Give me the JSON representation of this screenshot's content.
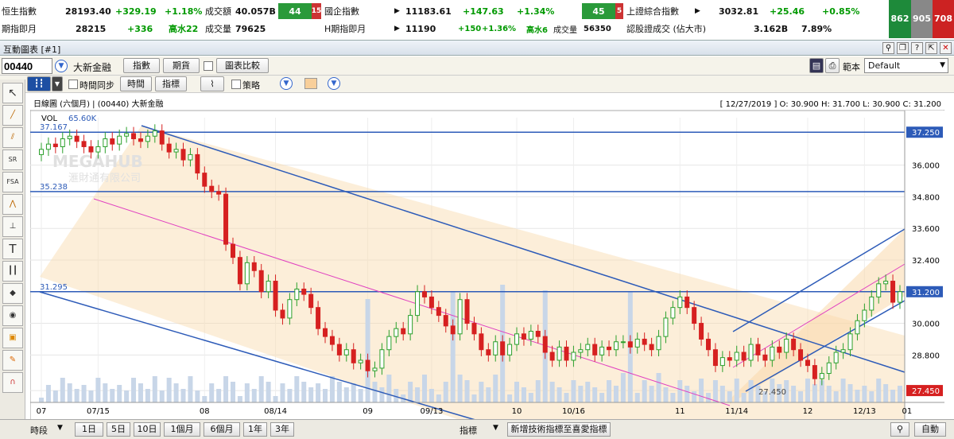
{
  "ticker": {
    "hsi_label": "恒生指數",
    "hsi_value": "28193.40",
    "hsi_change": "+329.19",
    "hsi_pct": "+1.18%",
    "hsi_turnover_label": "成交額",
    "hsi_turnover": "40.057B",
    "hsi_up_count": "44",
    "hsi_down_count": "15",
    "hsi_fut_label": "期指即月",
    "hsi_fut_value": "28215",
    "hsi_fut_change": "+336",
    "hsi_fut_premium": "高水22",
    "hsi_fut_vol_label": "成交量",
    "hsi_fut_vol": "79625",
    "hscei_label": "國企指數",
    "hscei_value": "11183.61",
    "hscei_change": "+147.63",
    "hscei_pct": "+1.34%",
    "hscei_up_count": "45",
    "hscei_down_count": "5",
    "hscei_fut_label": "H期指即月",
    "hscei_fut_value": "11190",
    "hscei_fut_change": "+150",
    "hscei_fut_pct": "+1.36%",
    "hscei_fut_premium": "高水6",
    "hscei_fut_vol_label": "成交量",
    "hscei_fut_vol": "56350",
    "sh_label": "上證綜合指數",
    "sh_value": "3032.81",
    "sh_change": "+25.46",
    "sh_pct": "+0.85%",
    "warrant_label": "認股證成交 (佔大市)",
    "warrant_value": "3.162B",
    "warrant_pct": "7.89%",
    "box1": "862",
    "box2": "905",
    "box3": "708"
  },
  "window": {
    "title": "互動圖表 [#1]"
  },
  "toolbar1": {
    "symbol": "00440",
    "name": "大新金融",
    "btn_index": "指數",
    "btn_futures": "期貨",
    "compare_label": "圖表比較",
    "template_label": "範本",
    "template_value": "Default"
  },
  "toolbar2": {
    "sync_label": "時間同步",
    "btn_time": "時間",
    "btn_indicator": "指標",
    "strategy_label": "策略"
  },
  "chart_header": {
    "left": "日線圖 (六個月) | (00440) 大新金融",
    "right": "[ 12/27/2019 ]  O: 30.900  H: 31.700  L: 30.900  C: 31.200",
    "vol_label": "VOL",
    "vol_value": "65.60K",
    "watermark": "MEGAHUB",
    "watermark_sub": "滙財通有限公司"
  },
  "left_tools": [
    "arrow",
    "trend",
    "channel",
    "SR",
    "FSA",
    "fibo",
    "level",
    "text",
    "multi",
    "eraser",
    "eye",
    "lock",
    "pencil",
    "magnet"
  ],
  "bottom": {
    "period_label": "時段",
    "periods": [
      "1日",
      "5日",
      "10日",
      "1個月",
      "6個月",
      "1年",
      "3年"
    ],
    "indicator_label": "指標",
    "add_indicator": "新增技術指標至喜愛指標",
    "btn_auto": "自動"
  },
  "chart_data": {
    "type": "candlestick",
    "yaxis_ticks": [
      37.25,
      36.0,
      34.8,
      33.6,
      32.4,
      31.2,
      30.0,
      28.8,
      27.45
    ],
    "ylim": [
      27.0,
      37.8
    ],
    "xaxis_labels": [
      "07",
      "07/15",
      "08",
      "08/14",
      "09",
      "09/13",
      "10",
      "10/16",
      "11",
      "11/14",
      "12",
      "12/13",
      "01"
    ],
    "hlines": [
      {
        "label": "37.167",
        "value": 37.25,
        "axis_label": "37.250"
      },
      {
        "label": "35.238",
        "value": 35.0
      },
      {
        "label": "31.295",
        "value": 31.2,
        "axis_label": "31.200"
      }
    ],
    "last_close": "31.200",
    "low_label": "27.450",
    "low_axis_label": "27.450",
    "closes": [
      36.6,
      36.8,
      36.7,
      37.0,
      37.1,
      36.9,
      36.7,
      36.5,
      36.7,
      37.0,
      36.8,
      37.1,
      37.2,
      37.0,
      36.9,
      37.1,
      37.3,
      36.8,
      36.5,
      36.6,
      36.2,
      36.4,
      35.7,
      35.2,
      35.0,
      34.9,
      33.0,
      32.5,
      31.5,
      32.3,
      32.0,
      31.2,
      31.6,
      30.5,
      30.2,
      30.9,
      31.3,
      31.1,
      30.6,
      29.8,
      29.5,
      29.2,
      28.8,
      29.0,
      28.5,
      28.6,
      28.2,
      28.3,
      29.0,
      29.5,
      29.8,
      29.6,
      30.3,
      31.2,
      31.0,
      30.6,
      30.3,
      29.9,
      29.6,
      30.9,
      30.0,
      29.6,
      29.0,
      28.8,
      29.3,
      28.8,
      29.2,
      29.6,
      29.4,
      29.7,
      29.5,
      28.9,
      28.6,
      29.1,
      28.6,
      28.9,
      29.0,
      29.2,
      28.8,
      29.1,
      29.0,
      29.3,
      29.3,
      29.1,
      29.4,
      29.2,
      29.0,
      29.5,
      30.2,
      30.6,
      31.0,
      30.6,
      30.0,
      29.4,
      29.0,
      28.4,
      28.7,
      28.6,
      28.9,
      28.6,
      29.2,
      28.8,
      28.6,
      29.1,
      28.9,
      29.4,
      29.0,
      28.6,
      28.4,
      27.9,
      28.1,
      28.5,
      28.9,
      29.0,
      29.6,
      30.1,
      30.5,
      31.0,
      31.5,
      31.6,
      30.8,
      31.2
    ]
  }
}
